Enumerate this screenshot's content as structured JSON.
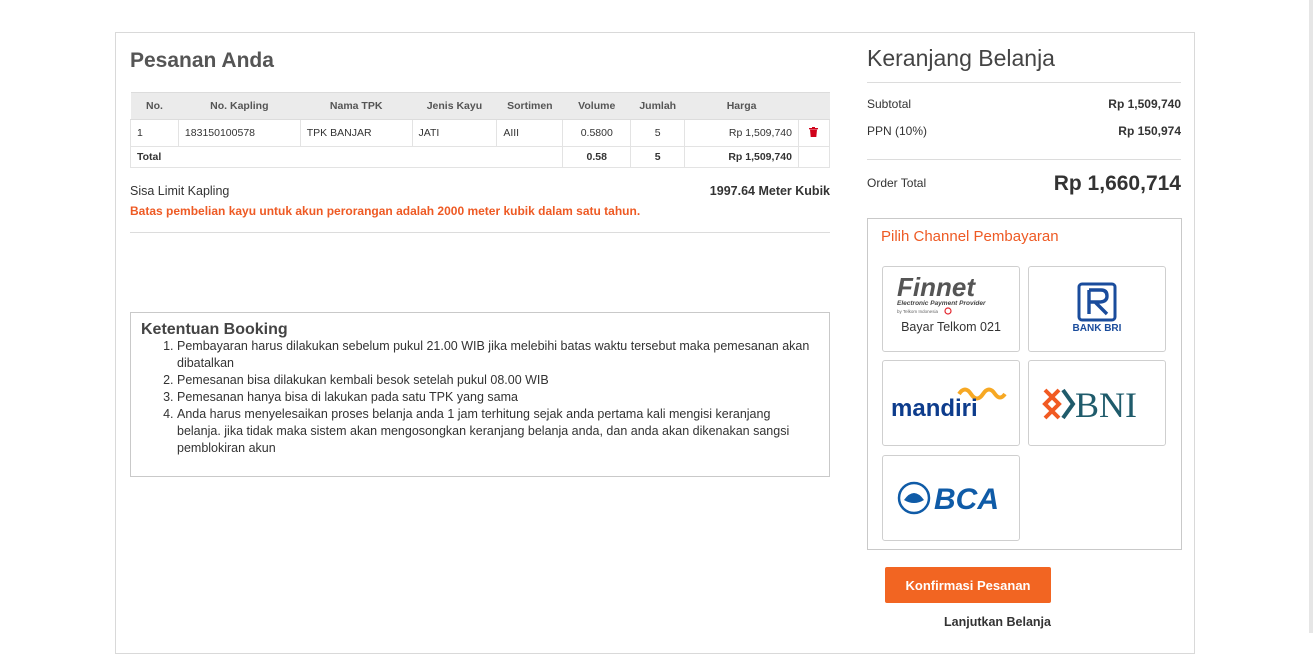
{
  "order": {
    "title": "Pesanan Anda",
    "headers": [
      "No.",
      "No. Kapling",
      "Nama TPK",
      "Jenis Kayu",
      "Sortimen",
      "Volume",
      "Jumlah",
      "Harga"
    ],
    "rows": [
      {
        "no": "1",
        "kapling": "183150100578",
        "tpk": "TPK BANJAR",
        "jenis": "JATI",
        "sortimen": "AIII",
        "volume": "0.5800",
        "jumlah": "5",
        "harga": "Rp 1,509,740",
        "action_icon": "trash-icon"
      }
    ],
    "total": {
      "label": "Total",
      "volume": "0.58",
      "jumlah": "5",
      "harga": "Rp 1,509,740"
    },
    "limit_label": "Sisa Limit Kapling",
    "limit_value": "1997.64 Meter Kubik",
    "limit_warning": "Batas pembelian kayu untuk akun perorangan adalah 2000 meter kubik dalam satu tahun."
  },
  "terms": {
    "title": "Ketentuan Booking",
    "items": [
      "Pembayaran harus dilakukan sebelum pukul 21.00 WIB jika melebihi batas waktu tersebut maka pemesanan akan dibatalkan",
      "Pemesanan bisa dilakukan kembali besok setelah pukul 08.00 WIB",
      "Pemesanan hanya bisa di lakukan pada satu TPK yang sama",
      "Anda harus menyelesaikan proses belanja anda 1 jam terhitung sejak anda pertama kali mengisi keranjang belanja. jika tidak maka sistem akan mengosongkan keranjang belanja anda, dan anda akan dikenakan sangsi pemblokiran akun"
    ]
  },
  "cart": {
    "title": "Keranjang Belanja",
    "subtotal_label": "Subtotal",
    "subtotal_value": "Rp 1,509,740",
    "ppn_label": "PPN (10%)",
    "ppn_value": "Rp 150,974",
    "total_label": "Order Total",
    "total_value": "Rp 1,660,714"
  },
  "payment": {
    "title": "Pilih Channel Pembayaran",
    "channels": [
      {
        "logo_text": "Finnet",
        "logo_sub": "Electronic Payment Provider",
        "logo_fine": "by Telkom Indonesia",
        "caption": "Bayar Telkom 021"
      },
      {
        "logo_text": "BANK BRI"
      },
      {
        "logo_text": "mandiri"
      },
      {
        "logo_text": "BNI"
      },
      {
        "logo_text": "BCA"
      }
    ]
  },
  "actions": {
    "confirm_label": "Konfirmasi Pesanan",
    "continue_label": "Lanjutkan Belanja"
  },
  "colors": {
    "accent": "#f26522",
    "warning_text": "#ee5a24",
    "delete_icon": "#d0021b",
    "bri_blue": "#1a4c9c",
    "mandiri_blue": "#0d3c8c",
    "mandiri_gold": "#f7a823",
    "bni_teal": "#1f5b6b",
    "bni_orange": "#f15a22",
    "bca_blue": "#0f5ba7"
  }
}
